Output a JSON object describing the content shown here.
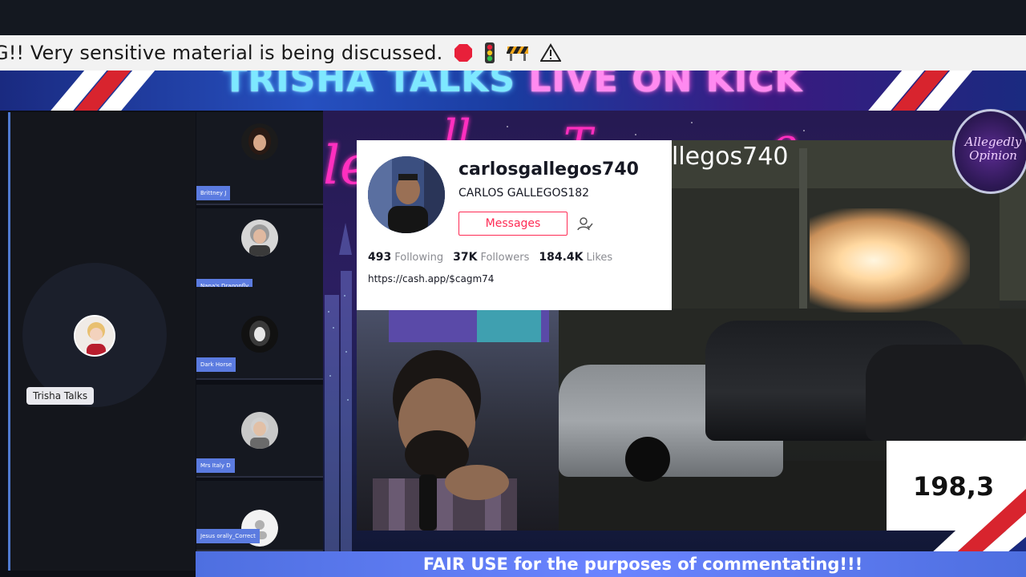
{
  "ticker": {
    "text": "G!! Very sensitive material is being discussed.",
    "icons": [
      "stop-sign-icon",
      "traffic-light-icon",
      "construction-barrier-icon",
      "warning-icon"
    ]
  },
  "banner": {
    "title_part1": "TRISHA TALKS",
    "title_part2": "LIVE ON KICK"
  },
  "speaker": {
    "name": "Trisha Talks"
  },
  "participants": [
    {
      "label": "Brittney J"
    },
    {
      "label": "Nana's Dragonfly"
    },
    {
      "label": "Dark Horse"
    },
    {
      "label": "Mrs Italy D"
    },
    {
      "label": "Jesus orally_Correct"
    }
  ],
  "profile": {
    "username": "carlosgallegos740",
    "nickname": "CARLOS GALLEGOS182",
    "message_button": "Messages",
    "stats": {
      "following_count": "493",
      "following_label": "Following",
      "followers_count": "37K",
      "followers_label": "Followers",
      "likes_count": "184.4K",
      "likes_label": "Likes"
    },
    "link": "https://cash.app/$cagm74"
  },
  "video": {
    "handle_overlay": "llegos740"
  },
  "subscriber": {
    "count": "198,3"
  },
  "bottom_banner": {
    "text": "FAIR USE for the purposes of commentating!!!"
  },
  "colors": {
    "accent_blue": "#5b7be0",
    "tiktok_red": "#fe2c55",
    "neon_pink": "#ff2fbf",
    "neon_cyan": "#7ee8ff"
  }
}
